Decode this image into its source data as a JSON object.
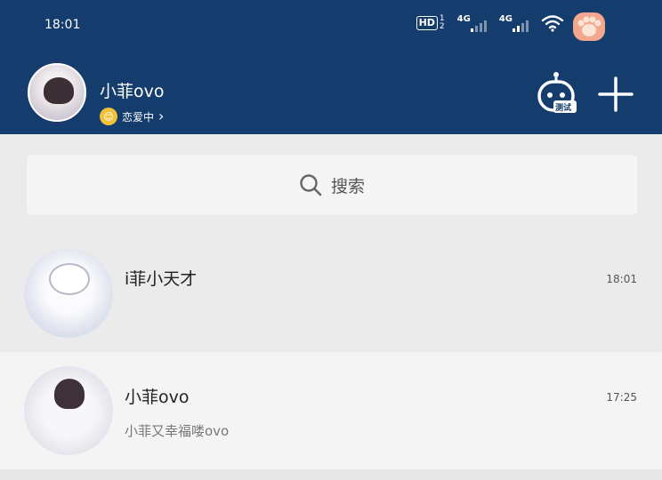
{
  "status_bar": {
    "time": "18:01",
    "hd_label": "HD",
    "hd_sup_top": "1",
    "hd_sup_bottom": "2",
    "sim1": "4G",
    "sim2": "4G",
    "icons": [
      "wifi-icon",
      "paw-icon"
    ]
  },
  "profile": {
    "username": "小菲ovo",
    "status_emoji": "😊",
    "status_text": "恋爱中",
    "status_chevron": "›"
  },
  "header_actions": {
    "robot_badge": "测试",
    "plus_icon": "plus-icon"
  },
  "search": {
    "placeholder": "搜索"
  },
  "chats": [
    {
      "name": "i菲小天才",
      "time": "18:01",
      "preview": ""
    },
    {
      "name": "小菲ovo",
      "time": "17:25",
      "preview": "小菲又幸福喽ovo"
    }
  ],
  "colors": {
    "header_bg": "#143c6c",
    "page_bg": "#ebebeb"
  }
}
